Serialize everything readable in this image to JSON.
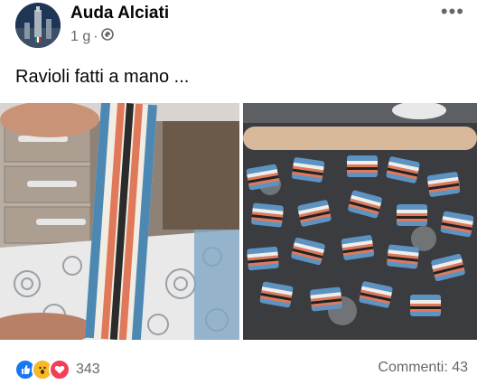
{
  "post": {
    "author": "Auda Alciati",
    "time": "1 g",
    "separator": "·",
    "audience_icon": "public-globe-icon",
    "more_icon": "ellipsis-icon",
    "text": "Ravioli fatti a mano ..."
  },
  "photos": [
    {
      "description_icon": "photo-pasta-sheet"
    },
    {
      "description_icon": "photo-ravioli-board"
    }
  ],
  "footer": {
    "reactions": [
      "like-icon",
      "wow-icon",
      "love-icon"
    ],
    "reaction_count": "343",
    "comments": "Commenti: 43"
  },
  "colors": {
    "like": "#1877f2",
    "love": "#f33e58",
    "wow": "#f7b928",
    "secondary_text": "#65676b"
  }
}
